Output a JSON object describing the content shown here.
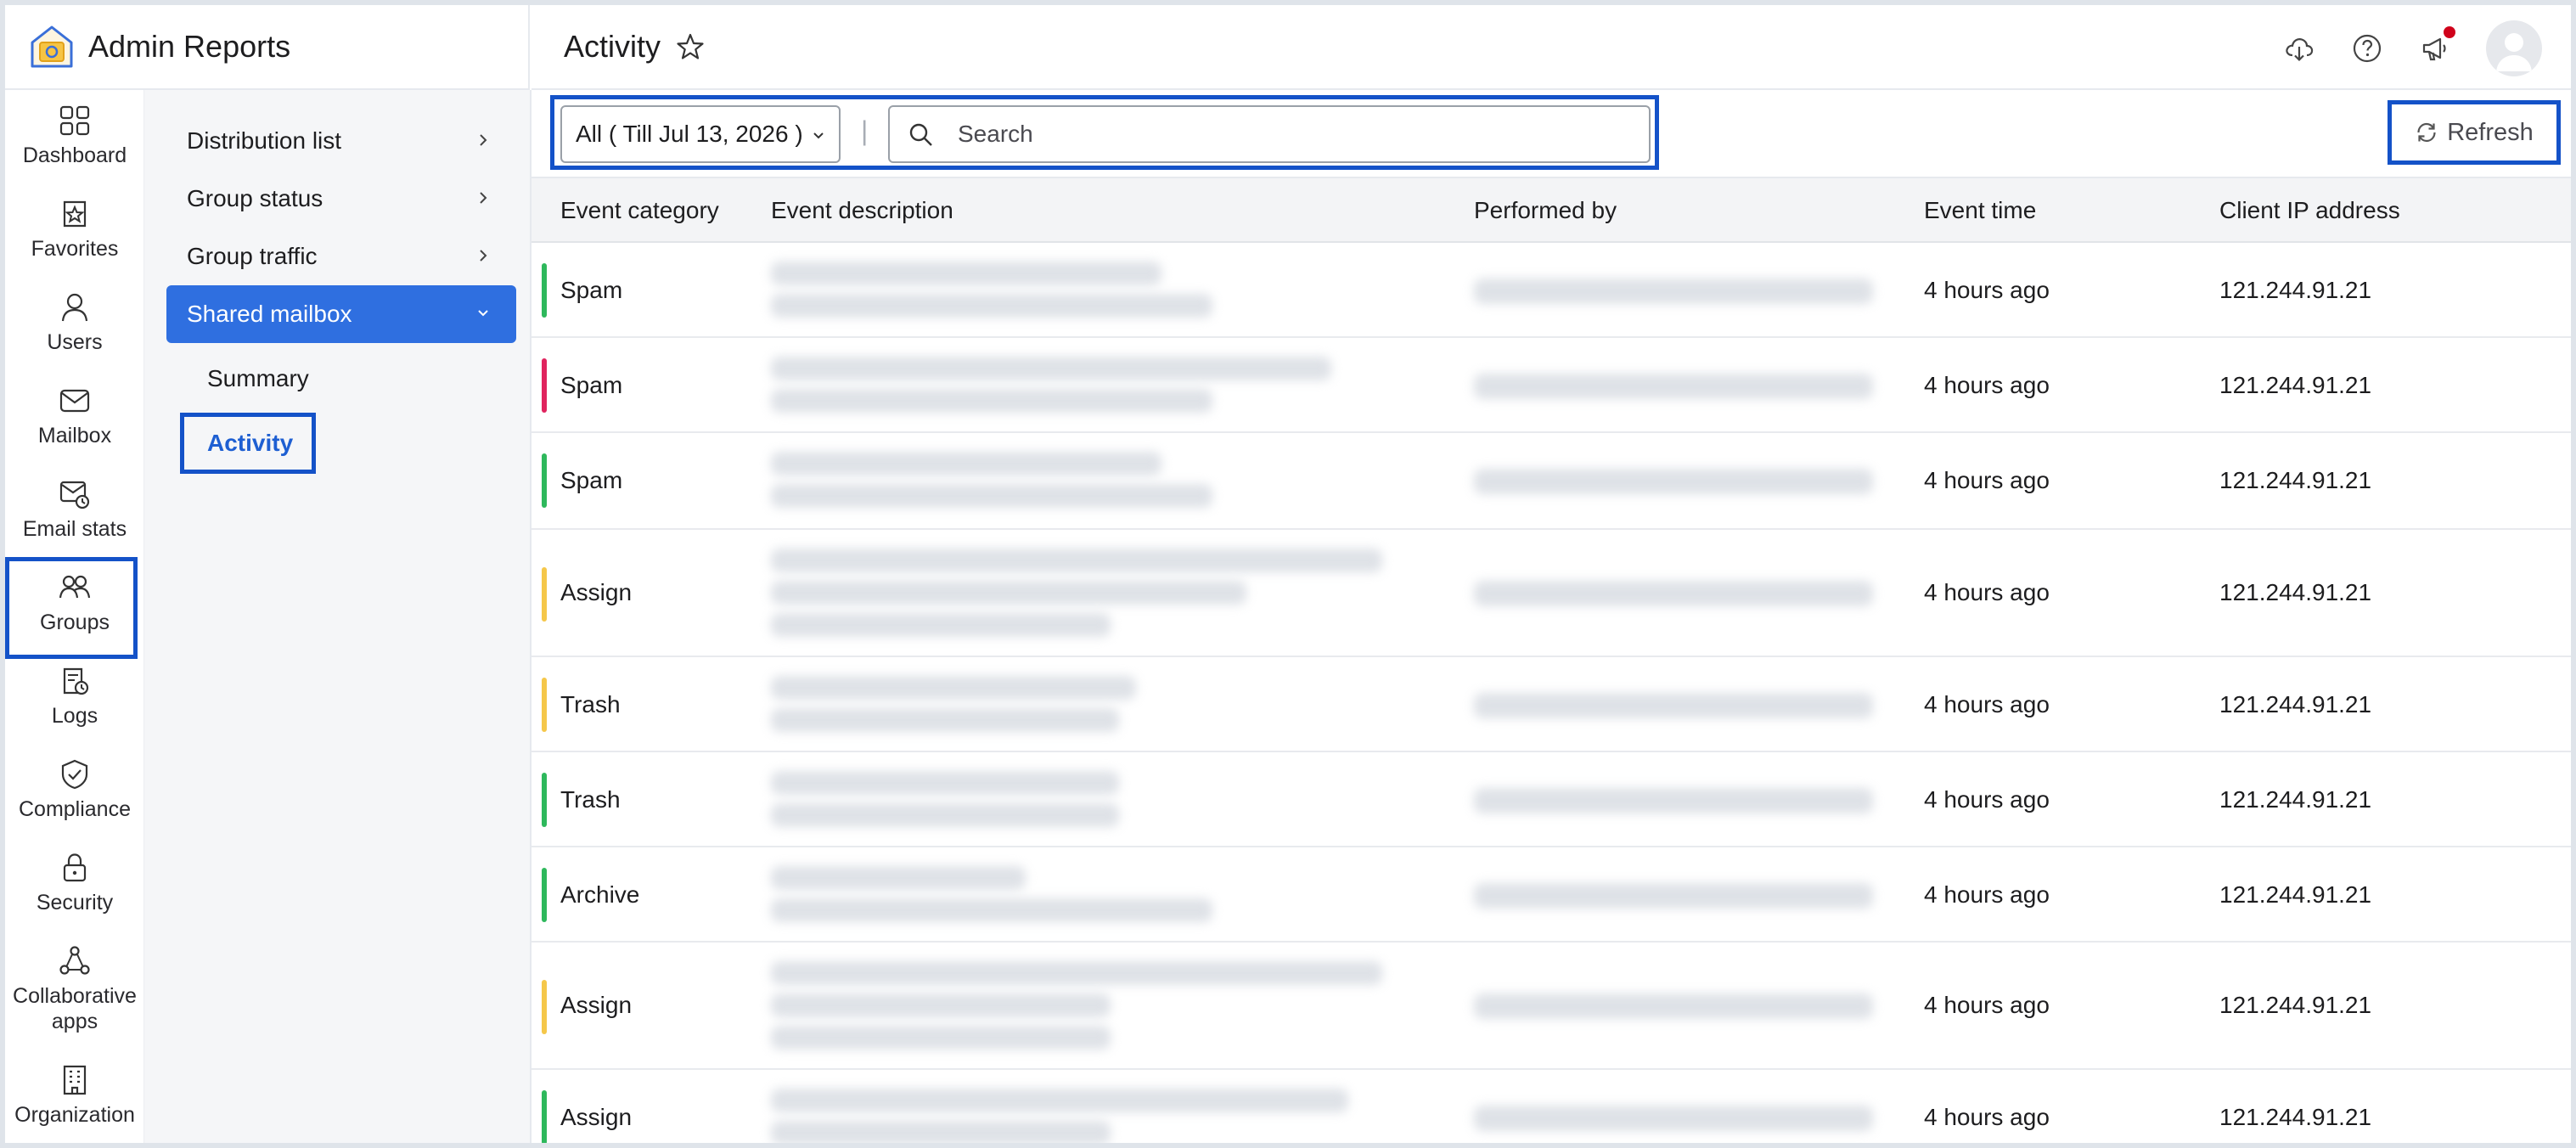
{
  "app": {
    "title": "Admin Reports",
    "accent": "#2f6fe0",
    "highlight": "#1452c8"
  },
  "header": {
    "page_title": "Activity",
    "icons": [
      "favorite-star-icon",
      "cloud-download-icon",
      "help-icon",
      "announcement-icon",
      "avatar"
    ]
  },
  "rail": {
    "items": [
      {
        "label": "Dashboard",
        "icon": "dashboard-icon"
      },
      {
        "label": "Favorites",
        "icon": "favorites-icon"
      },
      {
        "label": "Users",
        "icon": "user-icon"
      },
      {
        "label": "Mailbox",
        "icon": "mailbox-icon"
      },
      {
        "label": "Email stats",
        "icon": "email-stats-icon"
      },
      {
        "label": "Groups",
        "icon": "groups-icon",
        "active": true
      },
      {
        "label": "Logs",
        "icon": "logs-icon"
      },
      {
        "label": "Compliance",
        "icon": "compliance-icon"
      },
      {
        "label": "Security",
        "icon": "lock-icon"
      },
      {
        "label": "Collaborative apps",
        "icon": "collab-apps-icon"
      },
      {
        "label": "Organization",
        "icon": "organization-icon"
      }
    ]
  },
  "submenu": {
    "items": [
      {
        "label": "Distribution list"
      },
      {
        "label": "Group status"
      },
      {
        "label": "Group traffic"
      },
      {
        "label": "Shared mailbox",
        "active": true
      }
    ],
    "children": [
      {
        "label": "Summary"
      },
      {
        "label": "Activity",
        "active": true
      }
    ]
  },
  "toolbar": {
    "filter_label": "All ( Till Jul 13, 2026 )",
    "separator": "|",
    "search_placeholder": "Search",
    "refresh_label": "Refresh"
  },
  "table": {
    "columns": [
      "Event category",
      "Event description",
      "Performed by",
      "Event time",
      "Client IP address"
    ],
    "rows": [
      {
        "category": "Spam",
        "color": "#2eb85c",
        "time": "4 hours ago",
        "ip": "121.244.91.21"
      },
      {
        "category": "Spam",
        "color": "#e0245e",
        "time": "4 hours ago",
        "ip": "121.244.91.21"
      },
      {
        "category": "Spam",
        "color": "#2eb85c",
        "time": "4 hours ago",
        "ip": "121.244.91.21"
      },
      {
        "category": "Assign",
        "color": "#f5c74a",
        "time": "4 hours ago",
        "ip": "121.244.91.21"
      },
      {
        "category": "Trash",
        "color": "#f5c74a",
        "time": "4 hours ago",
        "ip": "121.244.91.21"
      },
      {
        "category": "Trash",
        "color": "#2eb85c",
        "time": "4 hours ago",
        "ip": "121.244.91.21"
      },
      {
        "category": "Archive",
        "color": "#2eb85c",
        "time": "4 hours ago",
        "ip": "121.244.91.21"
      },
      {
        "category": "Assign",
        "color": "#f5c74a",
        "time": "4 hours ago",
        "ip": "121.244.91.21"
      },
      {
        "category": "Assign",
        "color": "#2eb85c",
        "time": "4 hours ago",
        "ip": "121.244.91.21"
      }
    ]
  }
}
